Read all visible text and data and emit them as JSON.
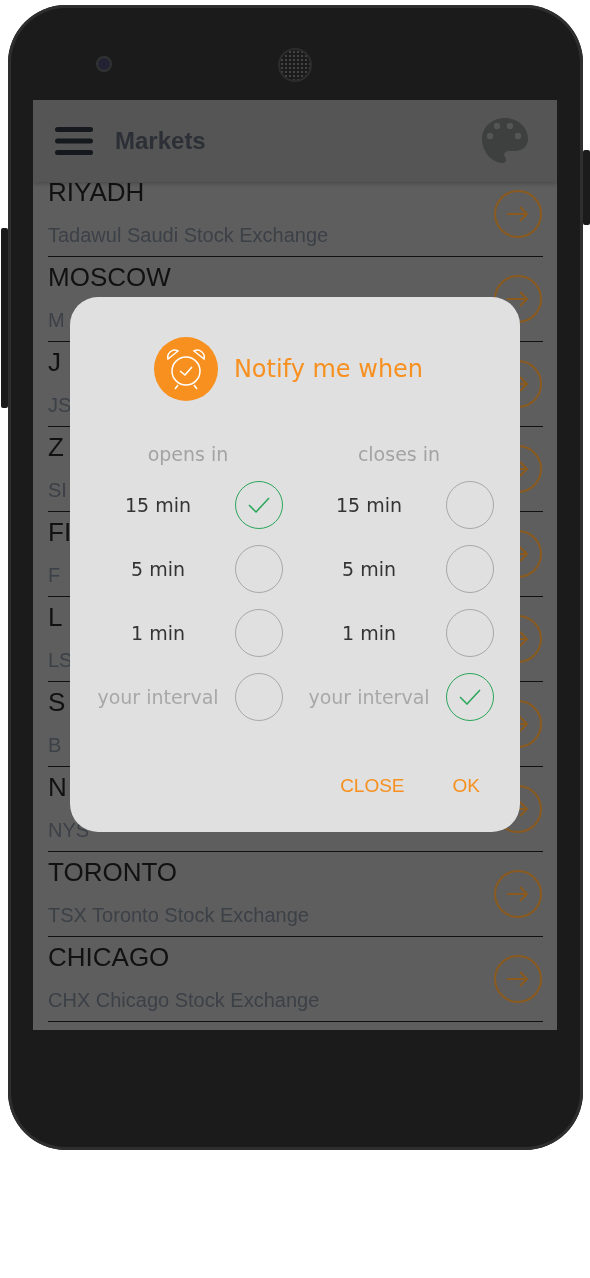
{
  "app_bar": {
    "title": "Markets"
  },
  "markets": [
    {
      "city": "RIYADH",
      "exchange": "Tadawul Saudi Stock Exchange"
    },
    {
      "city": "MOSCOW",
      "exchange": "M"
    },
    {
      "city": "J",
      "exchange": "JS"
    },
    {
      "city": "Z",
      "exchange": "SI"
    },
    {
      "city": "FI",
      "exchange": "F"
    },
    {
      "city": "L",
      "exchange": "LS"
    },
    {
      "city": "S",
      "exchange": "B"
    },
    {
      "city": "N",
      "exchange": "NYS"
    },
    {
      "city": "TORONTO",
      "exchange": "TSX Toronto Stock Exchange"
    },
    {
      "city": "CHICAGO",
      "exchange": "CHX Chicago Stock Exchange"
    }
  ],
  "dialog": {
    "title": "Notify me when",
    "columns": [
      {
        "heading": "opens in",
        "options": [
          {
            "label": "15 min",
            "kind": "preset",
            "selected": true
          },
          {
            "label": "5 min",
            "kind": "preset",
            "selected": false
          },
          {
            "label": "1 min",
            "kind": "preset",
            "selected": false
          },
          {
            "label": "your interval",
            "kind": "custom",
            "selected": false
          }
        ]
      },
      {
        "heading": "closes in",
        "options": [
          {
            "label": "15 min",
            "kind": "preset",
            "selected": false
          },
          {
            "label": "5 min",
            "kind": "preset",
            "selected": false
          },
          {
            "label": "1 min",
            "kind": "preset",
            "selected": false
          },
          {
            "label": "your interval",
            "kind": "custom",
            "selected": true
          }
        ]
      }
    ],
    "buttons": [
      "CLOSE",
      "OK"
    ]
  }
}
